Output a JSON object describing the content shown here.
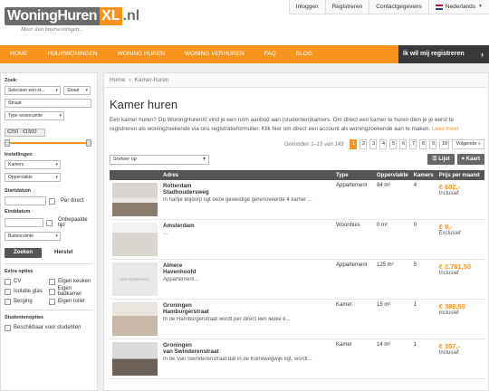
{
  "header": {
    "logo_main": "WoningHuren",
    "logo_xl": "XL",
    "logo_tld": ".nl",
    "tagline": "Meer dan huurwoningen...",
    "top_links": [
      "Inloggen",
      "Registreren",
      "Contactgegevens"
    ],
    "language": "Nederlands"
  },
  "nav": {
    "items": [
      "HOME",
      "HUURWONINGEN",
      "WONING HUREN",
      "WONING VERHUREN",
      "FAQ",
      "BLOG"
    ],
    "register": "Ik wil mij registreren"
  },
  "sidebar": {
    "search_label": "Zoek:",
    "select_city": "Selecteer een st...",
    "street_select": "Straat",
    "street_input": "Straat",
    "type_select": "Type woonruimte",
    "price_range": "€250 - €1500",
    "facilities_label": "Instellingen",
    "rooms_select": "Kamers",
    "area_select": "Oppervlakte",
    "start_label": "Startdatum",
    "per_direct": "Per direct",
    "end_label": "Einddatum",
    "indefinite": "Onbepaalde tijd",
    "outdoor_select": "Buitenruimte",
    "search_btn": "Zoeken",
    "reset_btn": "Herstel",
    "extras_label": "Extra opties",
    "extras": [
      "CV",
      "Eigen keuken",
      "Isolatie glas",
      "Eigen badkamer",
      "Berging",
      "Eigen toilet"
    ],
    "students_label": "Studentenopties",
    "students_option": "Beschikbaar voor studenten"
  },
  "content": {
    "breadcrumb_home": "Home",
    "breadcrumb_current": "Kamer-huren",
    "title": "Kamer huren",
    "intro": "Een kamer huren? Op WoningHurenXl vind je een ruim aanbod aan (studenten)kamers. Om direct een kamer te huren dien je je eerst te registreren als woningzoekende via ons registratieformulier. Klik hier om direct een account als woningzoekende aan te maken.",
    "read_more": "Lees meer",
    "found": "Gevonden 1–15 van 143",
    "pages": [
      "1",
      "2",
      "3",
      "4",
      "5",
      "6",
      "7",
      "8",
      "9",
      "10"
    ],
    "next": "Volgende »",
    "sort": "Sorteer op",
    "list_btn": "Lijst",
    "map_btn": "Kaart",
    "columns": [
      "",
      "Adres",
      "Type",
      "Oppervlakte",
      "Kamers",
      "Prijs per maand"
    ],
    "listings": [
      {
        "city": "Rotterdam",
        "street": "Stadhoudersweg",
        "desc": "In hartje Blijdorp ligt deze geweldige gerenoveerde 4 kamer ...",
        "type": "Appartement",
        "area": "84 m²",
        "rooms": "4",
        "price": "€ 602,-",
        "incl": "Inclusief"
      },
      {
        "city": "Amsterdam",
        "street": "",
        "desc": "...",
        "type": "Woonhuis",
        "area": "0 m²",
        "rooms": "0",
        "price": "€ 9,-",
        "incl": "Exclusief"
      },
      {
        "city": "Almere",
        "street": "Havenhoofd",
        "desc": "Appartement...",
        "type": "Appartement",
        "area": "125 m²",
        "rooms": "5",
        "price": "€ 2.761,50",
        "incl": "Inclusief"
      },
      {
        "city": "Groningen",
        "street": "Hamburgerstraat",
        "desc": "In de Hamburgerstraat wordt per direct een leuke k...",
        "type": "Kamer",
        "area": "15 m²",
        "rooms": "1",
        "price": "€ 388,50",
        "incl": "Inclusief"
      },
      {
        "city": "Groningen",
        "street": "van Swinderenstraat",
        "desc": "In de Van Swinderenstraat dat in de Korrewegwijk ligt, wordt...",
        "type": "Kamer",
        "area": "14 m²",
        "rooms": "1",
        "price": "€ 357,-",
        "incl": "Inclusief"
      }
    ],
    "placeholder_photo_text": "WoningHurenXL"
  },
  "colors": {
    "accent": "#f7941d",
    "dark": "#3a3a3a",
    "header_gray": "#555555"
  }
}
